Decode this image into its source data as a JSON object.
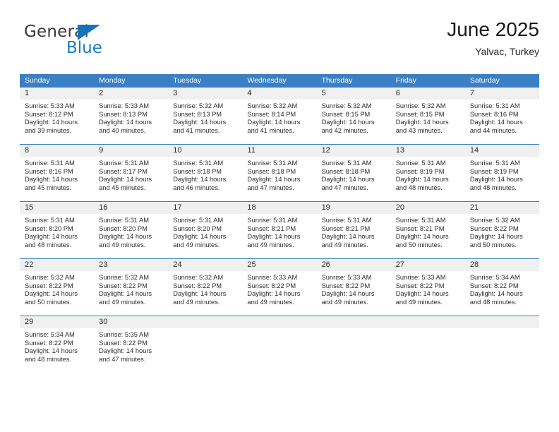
{
  "branding": {
    "logo_primary": "General",
    "logo_secondary": "Blue",
    "logo_mark": "triangle-icon",
    "primary_color": "#1b7bc4",
    "header_color": "#3b7fc4"
  },
  "header": {
    "title": "June 2025",
    "subtitle": "Yalvac, Turkey"
  },
  "weekdays": [
    "Sunday",
    "Monday",
    "Tuesday",
    "Wednesday",
    "Thursday",
    "Friday",
    "Saturday"
  ],
  "weeks": [
    [
      {
        "day": "1",
        "sunrise": "Sunrise: 5:33 AM",
        "sunset": "Sunset: 8:12 PM",
        "daylight_line1": "Daylight: 14 hours",
        "daylight_line2": "and 39 minutes."
      },
      {
        "day": "2",
        "sunrise": "Sunrise: 5:33 AM",
        "sunset": "Sunset: 8:13 PM",
        "daylight_line1": "Daylight: 14 hours",
        "daylight_line2": "and 40 minutes."
      },
      {
        "day": "3",
        "sunrise": "Sunrise: 5:32 AM",
        "sunset": "Sunset: 8:13 PM",
        "daylight_line1": "Daylight: 14 hours",
        "daylight_line2": "and 41 minutes."
      },
      {
        "day": "4",
        "sunrise": "Sunrise: 5:32 AM",
        "sunset": "Sunset: 8:14 PM",
        "daylight_line1": "Daylight: 14 hours",
        "daylight_line2": "and 41 minutes."
      },
      {
        "day": "5",
        "sunrise": "Sunrise: 5:32 AM",
        "sunset": "Sunset: 8:15 PM",
        "daylight_line1": "Daylight: 14 hours",
        "daylight_line2": "and 42 minutes."
      },
      {
        "day": "6",
        "sunrise": "Sunrise: 5:32 AM",
        "sunset": "Sunset: 8:15 PM",
        "daylight_line1": "Daylight: 14 hours",
        "daylight_line2": "and 43 minutes."
      },
      {
        "day": "7",
        "sunrise": "Sunrise: 5:31 AM",
        "sunset": "Sunset: 8:16 PM",
        "daylight_line1": "Daylight: 14 hours",
        "daylight_line2": "and 44 minutes."
      }
    ],
    [
      {
        "day": "8",
        "sunrise": "Sunrise: 5:31 AM",
        "sunset": "Sunset: 8:16 PM",
        "daylight_line1": "Daylight: 14 hours",
        "daylight_line2": "and 45 minutes."
      },
      {
        "day": "9",
        "sunrise": "Sunrise: 5:31 AM",
        "sunset": "Sunset: 8:17 PM",
        "daylight_line1": "Daylight: 14 hours",
        "daylight_line2": "and 45 minutes."
      },
      {
        "day": "10",
        "sunrise": "Sunrise: 5:31 AM",
        "sunset": "Sunset: 8:18 PM",
        "daylight_line1": "Daylight: 14 hours",
        "daylight_line2": "and 46 minutes."
      },
      {
        "day": "11",
        "sunrise": "Sunrise: 5:31 AM",
        "sunset": "Sunset: 8:18 PM",
        "daylight_line1": "Daylight: 14 hours",
        "daylight_line2": "and 47 minutes."
      },
      {
        "day": "12",
        "sunrise": "Sunrise: 5:31 AM",
        "sunset": "Sunset: 8:18 PM",
        "daylight_line1": "Daylight: 14 hours",
        "daylight_line2": "and 47 minutes."
      },
      {
        "day": "13",
        "sunrise": "Sunrise: 5:31 AM",
        "sunset": "Sunset: 8:19 PM",
        "daylight_line1": "Daylight: 14 hours",
        "daylight_line2": "and 48 minutes."
      },
      {
        "day": "14",
        "sunrise": "Sunrise: 5:31 AM",
        "sunset": "Sunset: 8:19 PM",
        "daylight_line1": "Daylight: 14 hours",
        "daylight_line2": "and 48 minutes."
      }
    ],
    [
      {
        "day": "15",
        "sunrise": "Sunrise: 5:31 AM",
        "sunset": "Sunset: 8:20 PM",
        "daylight_line1": "Daylight: 14 hours",
        "daylight_line2": "and 48 minutes."
      },
      {
        "day": "16",
        "sunrise": "Sunrise: 5:31 AM",
        "sunset": "Sunset: 8:20 PM",
        "daylight_line1": "Daylight: 14 hours",
        "daylight_line2": "and 49 minutes."
      },
      {
        "day": "17",
        "sunrise": "Sunrise: 5:31 AM",
        "sunset": "Sunset: 8:20 PM",
        "daylight_line1": "Daylight: 14 hours",
        "daylight_line2": "and 49 minutes."
      },
      {
        "day": "18",
        "sunrise": "Sunrise: 5:31 AM",
        "sunset": "Sunset: 8:21 PM",
        "daylight_line1": "Daylight: 14 hours",
        "daylight_line2": "and 49 minutes."
      },
      {
        "day": "19",
        "sunrise": "Sunrise: 5:31 AM",
        "sunset": "Sunset: 8:21 PM",
        "daylight_line1": "Daylight: 14 hours",
        "daylight_line2": "and 49 minutes."
      },
      {
        "day": "20",
        "sunrise": "Sunrise: 5:31 AM",
        "sunset": "Sunset: 8:21 PM",
        "daylight_line1": "Daylight: 14 hours",
        "daylight_line2": "and 50 minutes."
      },
      {
        "day": "21",
        "sunrise": "Sunrise: 5:32 AM",
        "sunset": "Sunset: 8:22 PM",
        "daylight_line1": "Daylight: 14 hours",
        "daylight_line2": "and 50 minutes."
      }
    ],
    [
      {
        "day": "22",
        "sunrise": "Sunrise: 5:32 AM",
        "sunset": "Sunset: 8:22 PM",
        "daylight_line1": "Daylight: 14 hours",
        "daylight_line2": "and 50 minutes."
      },
      {
        "day": "23",
        "sunrise": "Sunrise: 5:32 AM",
        "sunset": "Sunset: 8:22 PM",
        "daylight_line1": "Daylight: 14 hours",
        "daylight_line2": "and 49 minutes."
      },
      {
        "day": "24",
        "sunrise": "Sunrise: 5:32 AM",
        "sunset": "Sunset: 8:22 PM",
        "daylight_line1": "Daylight: 14 hours",
        "daylight_line2": "and 49 minutes."
      },
      {
        "day": "25",
        "sunrise": "Sunrise: 5:33 AM",
        "sunset": "Sunset: 8:22 PM",
        "daylight_line1": "Daylight: 14 hours",
        "daylight_line2": "and 49 minutes."
      },
      {
        "day": "26",
        "sunrise": "Sunrise: 5:33 AM",
        "sunset": "Sunset: 8:22 PM",
        "daylight_line1": "Daylight: 14 hours",
        "daylight_line2": "and 49 minutes."
      },
      {
        "day": "27",
        "sunrise": "Sunrise: 5:33 AM",
        "sunset": "Sunset: 8:22 PM",
        "daylight_line1": "Daylight: 14 hours",
        "daylight_line2": "and 49 minutes."
      },
      {
        "day": "28",
        "sunrise": "Sunrise: 5:34 AM",
        "sunset": "Sunset: 8:22 PM",
        "daylight_line1": "Daylight: 14 hours",
        "daylight_line2": "and 48 minutes."
      }
    ],
    [
      {
        "day": "29",
        "sunrise": "Sunrise: 5:34 AM",
        "sunset": "Sunset: 8:22 PM",
        "daylight_line1": "Daylight: 14 hours",
        "daylight_line2": "and 48 minutes."
      },
      {
        "day": "30",
        "sunrise": "Sunrise: 5:35 AM",
        "sunset": "Sunset: 8:22 PM",
        "daylight_line1": "Daylight: 14 hours",
        "daylight_line2": "and 47 minutes."
      },
      {
        "day": "",
        "sunrise": "",
        "sunset": "",
        "daylight_line1": "",
        "daylight_line2": ""
      },
      {
        "day": "",
        "sunrise": "",
        "sunset": "",
        "daylight_line1": "",
        "daylight_line2": ""
      },
      {
        "day": "",
        "sunrise": "",
        "sunset": "",
        "daylight_line1": "",
        "daylight_line2": ""
      },
      {
        "day": "",
        "sunrise": "",
        "sunset": "",
        "daylight_line1": "",
        "daylight_line2": ""
      },
      {
        "day": "",
        "sunrise": "",
        "sunset": "",
        "daylight_line1": "",
        "daylight_line2": ""
      }
    ]
  ]
}
